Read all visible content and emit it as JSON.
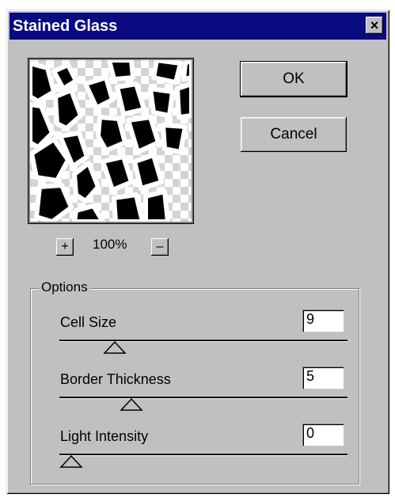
{
  "window": {
    "title": "Stained Glass"
  },
  "titlebar": {
    "close_glyph": "×"
  },
  "preview": {
    "zoom_in_glyph": "+",
    "zoom_out_glyph": "–",
    "zoom_level": "100%"
  },
  "buttons": {
    "ok": "OK",
    "cancel": "Cancel"
  },
  "options": {
    "legend": "Options",
    "cell_size": {
      "label": "Cell Size",
      "value": "9",
      "slider_fraction": 0.15
    },
    "border_thickness": {
      "label": "Border Thickness",
      "value": "5",
      "slider_fraction": 0.21
    },
    "light_intensity": {
      "label": "Light Intensity",
      "value": "0",
      "slider_fraction": 0.0
    }
  },
  "colors": {
    "titlebar": "#0a0a82",
    "face": "#c0c0c0",
    "title_text": "#ffffff"
  }
}
